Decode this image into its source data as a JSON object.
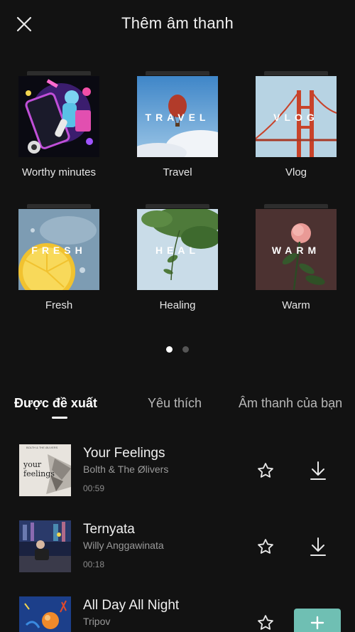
{
  "header": {
    "title": "Thêm âm thanh",
    "close_icon": "close-icon"
  },
  "categories": [
    {
      "label": "Worthy minutes",
      "overlay": ""
    },
    {
      "label": "Travel",
      "overlay": "TRAVEL"
    },
    {
      "label": "Vlog",
      "overlay": "VLOG"
    },
    {
      "label": "Fresh",
      "overlay": "FRESH"
    },
    {
      "label": "Healing",
      "overlay": "HEAL"
    },
    {
      "label": "Warm",
      "overlay": "WARM"
    }
  ],
  "pagination": {
    "pages": 2,
    "current": 1
  },
  "tabs": [
    {
      "label": "Được đề xuất",
      "active": true
    },
    {
      "label": "Yêu thích",
      "active": false
    },
    {
      "label": "Âm thanh của bạn",
      "active": false
    }
  ],
  "tracks": [
    {
      "title": "Your Feelings",
      "artist": "Bolth & The Ølivers",
      "duration": "00:59",
      "action": "download-icon"
    },
    {
      "title": "Ternyata",
      "artist": "Willy Anggawinata",
      "duration": "00:18",
      "action": "download-icon"
    },
    {
      "title": "All Day All Night",
      "artist": "Tripov",
      "duration": "",
      "action": "plus-icon"
    }
  ],
  "cover_text": {
    "your_feelings": "your feelings",
    "small_caption": "BOLTH & THE ØLIVERS"
  },
  "colors": {
    "background": "#121212",
    "accent_add": "#6fbfb3",
    "dot_active": "#ffffff",
    "dot_inactive": "#555555",
    "tab_inactive": "#b8b8b8"
  }
}
